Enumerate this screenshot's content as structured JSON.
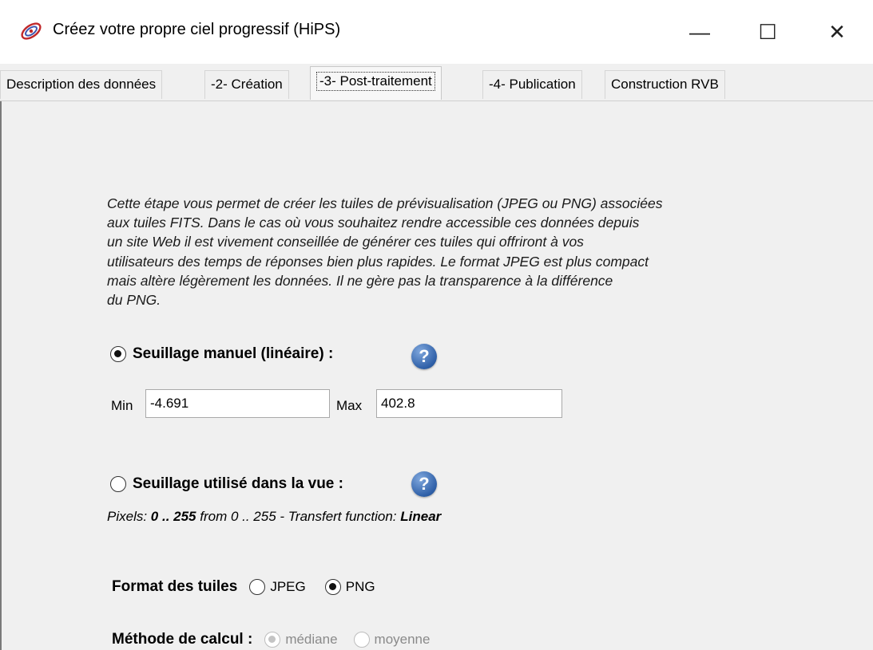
{
  "window": {
    "title": "Créez votre propre ciel progressif (HiPS)",
    "minimize": "—",
    "maximize": "☐",
    "close": "✕"
  },
  "tabs": [
    {
      "label": "Description des données"
    },
    {
      "label": "-2- Création"
    },
    {
      "label": "-3- Post-traitement",
      "active": true
    },
    {
      "label": "-4- Publication"
    },
    {
      "label": "Construction RVB"
    }
  ],
  "description": [
    "Cette étape vous permet de créer les tuiles de prévisualisation (JPEG ou PNG) associées",
    "aux tuiles FITS. Dans le cas où vous souhaitez rendre accessible ces données depuis",
    "un site Web il est vivement conseillée de générer ces tuiles qui offriront à vos",
    "utilisateurs des temps de réponses bien plus rapides. Le format JPEG est plus compact",
    "mais altère légèrement les données. Il ne gère pas la transparence à la différence",
    "du PNG."
  ],
  "manual_threshold": {
    "label": "Seuillage manuel (linéaire) :",
    "selected": true,
    "help": "?",
    "min_label": "Min",
    "min_value": "-4.691",
    "max_label": "Max",
    "max_value": "402.8"
  },
  "view_threshold": {
    "label": "Seuillage utilisé dans la vue :",
    "selected": false,
    "help": "?"
  },
  "pixels_info": {
    "prefix": "Pixels: ",
    "range": "0 .. 255",
    "middle": " from 0 .. 255 - Transfert function: ",
    "function": "Linear"
  },
  "tile_format": {
    "label": "Format des tuiles",
    "options": [
      {
        "label": "JPEG",
        "selected": false
      },
      {
        "label": "PNG",
        "selected": true
      }
    ]
  },
  "method": {
    "label": "Méthode de calcul :",
    "options": [
      {
        "label": "médiane",
        "selected": true,
        "disabled": true
      },
      {
        "label": "moyenne",
        "selected": false,
        "disabled": true
      }
    ]
  },
  "icons": {
    "app": "hips-galaxy-icon",
    "help": "question-help-icon"
  },
  "colors": {
    "panel_bg": "#f0f0f0",
    "help_blue": "#2f60a8"
  }
}
